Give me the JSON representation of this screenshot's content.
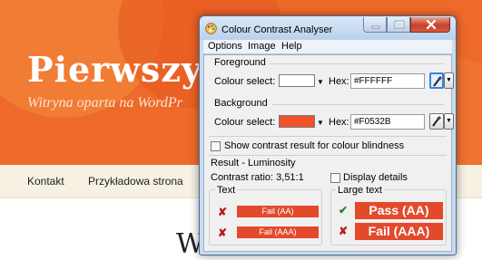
{
  "website": {
    "title": "Pierwszy",
    "tagline": "Witryna oparta na WordPr",
    "nav": [
      "Kontakt",
      "Przykładowa strona"
    ],
    "heading": "W",
    "header_color": "#EE6A2A"
  },
  "window": {
    "title": "Colour Contrast Analyser",
    "menu": [
      "Options",
      "Image",
      "Help"
    ],
    "foreground": {
      "section_label": "Foreground",
      "colour_select_label": "Colour select:",
      "hex_label": "Hex:",
      "hex_value": "#FFFFFF",
      "swatch_color": "#FFFFFF"
    },
    "background": {
      "section_label": "Background",
      "colour_select_label": "Colour select:",
      "hex_label": "Hex:",
      "hex_value": "#F0532B",
      "swatch_color": "#F0532B"
    },
    "colour_blindness_label": "Show contrast result for colour blindness",
    "result": {
      "section_label": "Result - Luminosity",
      "contrast_ratio": "Contrast ratio: 3,51:1",
      "display_details_label": "Display details",
      "text_group": {
        "label": "Text",
        "aa": "Fail (AA)",
        "aaa": "Fail (AAA)"
      },
      "large_text_group": {
        "label": "Large text",
        "aa": "Pass (AA)",
        "aaa": "Fail (AAA)"
      },
      "fail_color": "#E24A2B",
      "pass_icon_color": "#2E7D32",
      "fail_icon_color": "#B71C1C"
    }
  }
}
